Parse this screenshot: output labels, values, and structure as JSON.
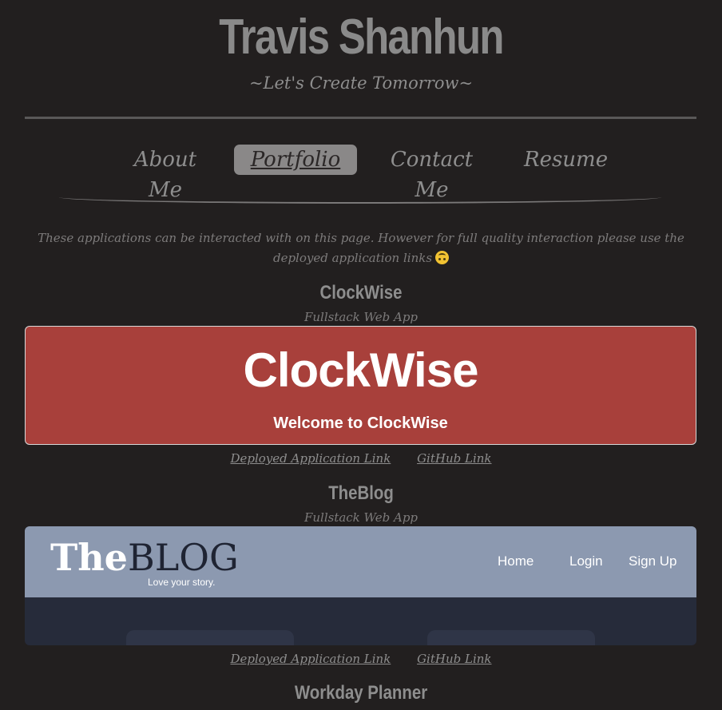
{
  "header": {
    "name": "Travis Shanhun",
    "tagline": "~Let's Create Tomorrow~"
  },
  "nav": {
    "items": [
      {
        "label": "About Me",
        "active": false
      },
      {
        "label": "Portfolio",
        "active": true
      },
      {
        "label": "Contact Me",
        "active": false
      },
      {
        "label": "Resume",
        "active": false
      }
    ]
  },
  "intro": {
    "text": "These applications can be interacted with on this page. However for full quality interaction please use the deployed application links",
    "emoji": "upside-down-face-icon"
  },
  "projects": [
    {
      "title": "ClockWise",
      "subtitle": "Fullstack Web App",
      "preview": {
        "logo": "ClockWise",
        "welcome": "Welcome to ClockWise",
        "background": "#a8403b"
      },
      "deployed_label": "Deployed Application Link",
      "github_label": "GitHub Link"
    },
    {
      "title": "TheBlog",
      "subtitle": "Fullstack Web App",
      "preview": {
        "logo_the": "The",
        "logo_blog": "BLOG",
        "tagline": "Love your story.",
        "nav": [
          "Home",
          "Login",
          "Sign Up"
        ],
        "header_background": "#8c99b0",
        "body_background": "#262b3a"
      },
      "deployed_label": "Deployed Application Link",
      "github_label": "GitHub Link"
    },
    {
      "title": "Workday Planner"
    }
  ],
  "colors": {
    "background": "#221f1f",
    "text": "#8e8e8e",
    "active_tab": "#8a8888"
  }
}
